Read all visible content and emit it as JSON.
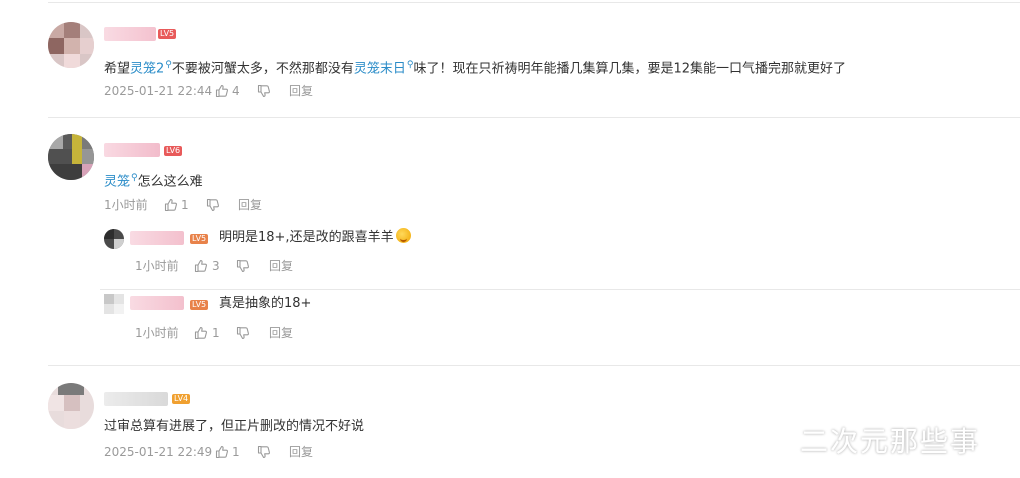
{
  "comments": [
    {
      "badge": "LV5",
      "text_before": "希望",
      "link1": "灵笼2",
      "text_mid": "不要被河蟹太多，不然那都没有",
      "link2": "灵笼末日",
      "text_after": "味了！现在只祈祷明年能播几集算几集，要是12集能一口气播完那就更好了",
      "time": "2025-01-21 22:44",
      "likes": "4",
      "reply": "回复"
    },
    {
      "badge": "LV6",
      "link1": "灵笼",
      "text_after": "怎么这么难",
      "time": "1小时前",
      "likes": "1",
      "reply": "回复",
      "replies": [
        {
          "badge": "LV5",
          "text": "明明是18+,还是改的跟喜羊羊",
          "time": "1小时前",
          "likes": "3",
          "reply": "回复"
        },
        {
          "badge": "LV5",
          "text": "真是抽象的18+",
          "time": "1小时前",
          "likes": "1",
          "reply": "回复"
        }
      ]
    },
    {
      "badge": "LV4",
      "text": "过审总算有进展了，但正片删改的情况不好说",
      "time": "2025-01-21 22:49",
      "likes": "1",
      "reply": "回复"
    }
  ],
  "watermark": "二次元那些事",
  "icons": {
    "like": "thumbs-up-icon",
    "dislike": "thumbs-down-icon",
    "link": "search-link-icon",
    "emoji": "laughing-emoji-icon"
  },
  "colors": {
    "link": "#2a8cc8",
    "badge_lv5": "#e85a5a",
    "badge_lv4": "#f0a030",
    "meta": "#9a9a9a"
  }
}
